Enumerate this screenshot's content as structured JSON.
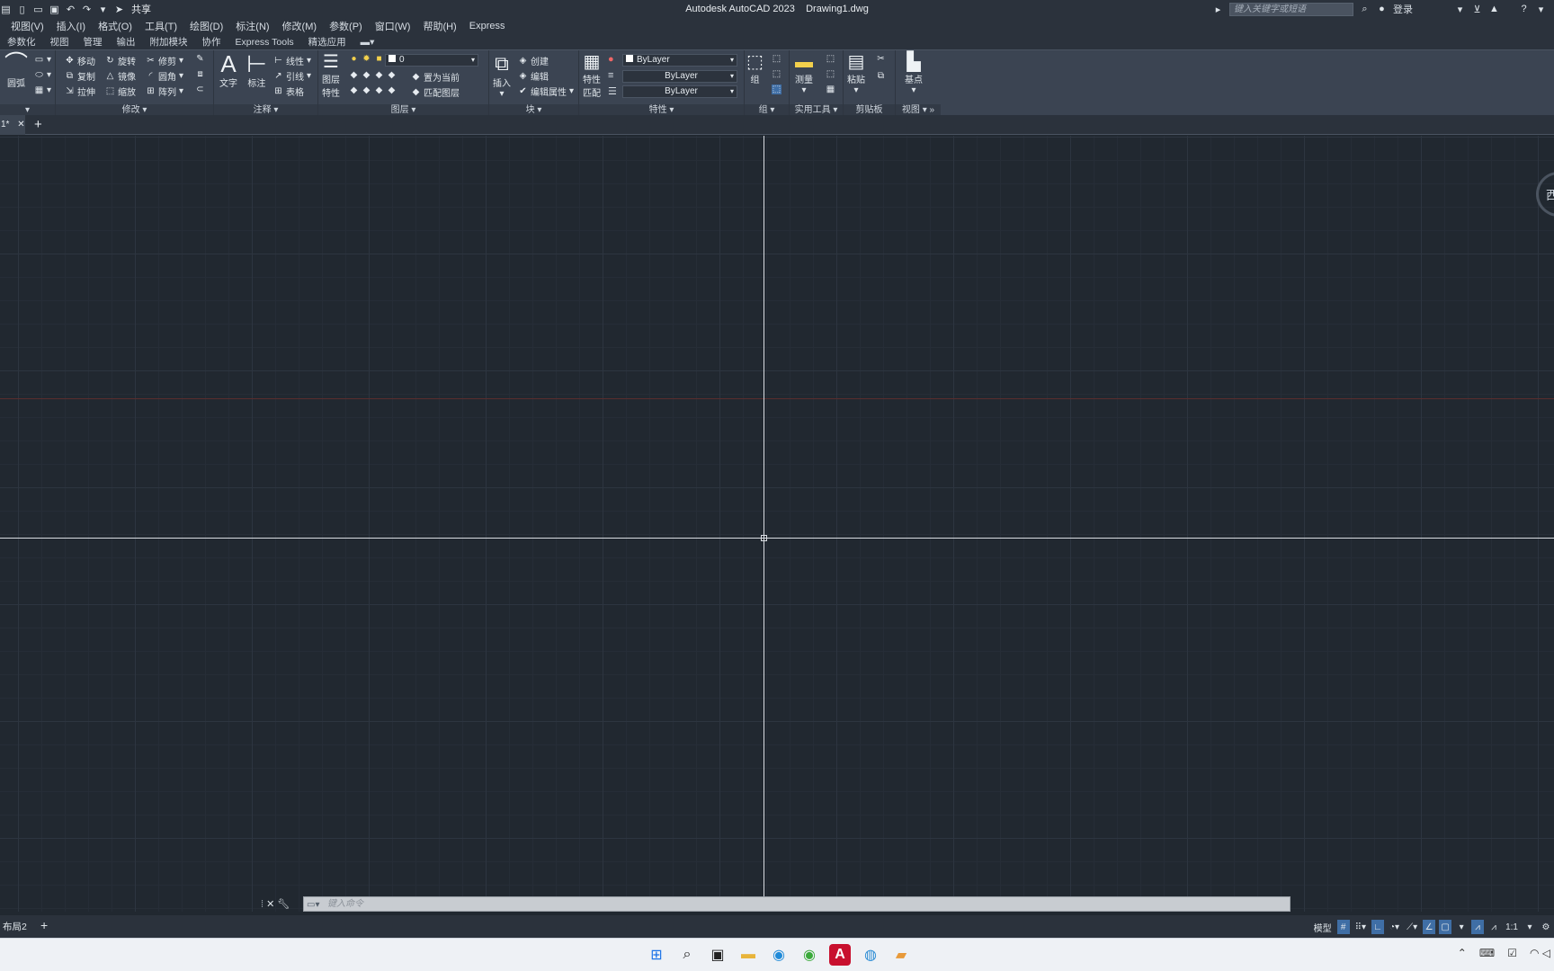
{
  "window": {
    "title": "Autodesk AutoCAD 2023    Drawing1.dwg",
    "share_label": "共享",
    "search_placeholder": "键入关键字或短语",
    "login_label": "登录",
    "help_icon": "help-icon"
  },
  "menu": [
    "视图(V)",
    "插入(I)",
    "格式(O)",
    "工具(T)",
    "绘图(D)",
    "标注(N)",
    "修改(M)",
    "参数(P)",
    "窗口(W)",
    "帮助(H)",
    "Express"
  ],
  "ribbon_tabs": [
    "参数化",
    "视图",
    "管理",
    "输出",
    "附加模块",
    "协作",
    "Express Tools",
    "精选应用"
  ],
  "ribbon": {
    "draw": {
      "circle": "圆弧"
    },
    "modify": {
      "title": "修改",
      "move": "移动",
      "rotate": "旋转",
      "trim": "修剪",
      "copy": "复制",
      "mirror": "镜像",
      "fillet": "圆角",
      "stretch": "拉伸",
      "scale": "缩放",
      "array": "阵列"
    },
    "annotation": {
      "title": "注释",
      "text": "文字",
      "dimension": "标注",
      "linear": "线性",
      "leader": "引线",
      "table": "表格"
    },
    "layers": {
      "title": "图层",
      "layer_props_1": "图层",
      "layer_props_2": "特性",
      "current_layer": "0",
      "set_current": "置为当前",
      "match_layer": "匹配图层"
    },
    "block": {
      "title": "块",
      "insert": "插入",
      "create": "创建",
      "edit": "编辑",
      "edit_attr": "编辑属性"
    },
    "properties": {
      "title": "特性",
      "match_1": "特性",
      "match_2": "匹配",
      "color": "ByLayer",
      "linetype": "ByLayer",
      "lineweight": "ByLayer"
    },
    "groups": {
      "title": "组",
      "group": "组"
    },
    "utilities": {
      "title": "实用工具",
      "measure": "测量"
    },
    "clipboard": {
      "title": "剪贴板",
      "paste": "粘贴"
    },
    "view": {
      "title": "视图",
      "basepoint": "基点"
    }
  },
  "document_tab": "1*",
  "viewcube_label": "西",
  "command_line": {
    "placeholder": "键入命令"
  },
  "layout_tab": "布局2",
  "status_bar": {
    "model": "模型",
    "scale": "1:1"
  },
  "colors": {
    "canvas": "#212830",
    "ribbon": "#3b4452",
    "accent": "#3f6ea5"
  }
}
